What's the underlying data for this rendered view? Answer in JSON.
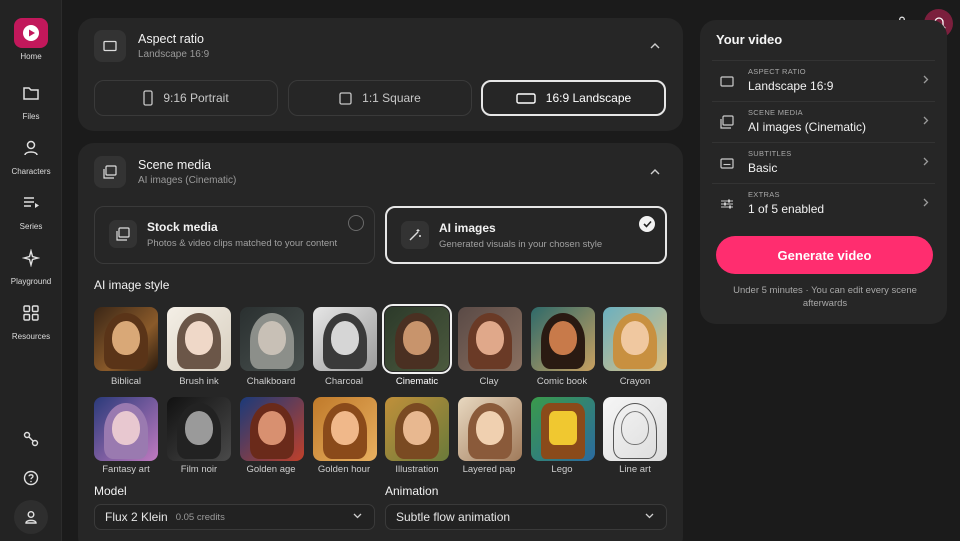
{
  "sidebar": {
    "items": [
      {
        "label": "Home",
        "icon": "home-icon"
      },
      {
        "label": "Files",
        "icon": "folder-icon"
      },
      {
        "label": "Characters",
        "icon": "person-icon"
      },
      {
        "label": "Series",
        "icon": "list-icon"
      },
      {
        "label": "Playground",
        "icon": "sparkle-icon"
      },
      {
        "label": "Resources",
        "icon": "grid-icon"
      }
    ],
    "bottom": [
      "link-icon",
      "help-icon",
      "account-icon"
    ],
    "accent": "#c2185b"
  },
  "aspect": {
    "title": "Aspect ratio",
    "subtitle": "Landscape 16:9",
    "options": [
      "9:16 Portrait",
      "1:1 Square",
      "16:9 Landscape"
    ],
    "selected": "16:9 Landscape"
  },
  "scene": {
    "title": "Scene media",
    "subtitle": "AI images (Cinematic)",
    "options": [
      {
        "title": "Stock media",
        "desc": "Photos & video clips matched to your content"
      },
      {
        "title": "AI images",
        "desc": "Generated visuals in your chosen style"
      }
    ],
    "selected": "AI images"
  },
  "styles": {
    "heading": "AI image style",
    "row1": [
      "Biblical",
      "Brush ink",
      "Chalkboard",
      "Charcoal",
      "Cinematic",
      "Clay",
      "Comic book",
      "Crayon"
    ],
    "row2": [
      "Fantasy art",
      "Film noir",
      "Golden age",
      "Golden hour",
      "Illustration",
      "Layered pap",
      "Lego",
      "Line art"
    ],
    "selected": "Cinematic"
  },
  "model": {
    "label": "Model",
    "value": "Flux 2 Klein",
    "credits": "0.05 credits"
  },
  "animation": {
    "label": "Animation",
    "value": "Subtle flow animation"
  },
  "summary": {
    "title": "Your video",
    "rows": [
      {
        "caption": "ASPECT RATIO",
        "value": "Landscape 16:9"
      },
      {
        "caption": "SCENE MEDIA",
        "value": "AI images (Cinematic)"
      },
      {
        "caption": "SUBTITLES",
        "value": "Basic"
      },
      {
        "caption": "EXTRAS",
        "value": "1 of 5 enabled"
      }
    ],
    "button": "Generate video",
    "note": "Under 5 minutes · You can edit every scene afterwards",
    "button_color": "#ff2d6f"
  }
}
